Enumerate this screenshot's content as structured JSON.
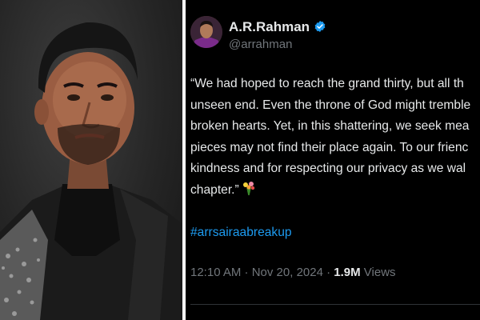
{
  "tweet": {
    "display_name": "A.R.Rahman",
    "handle": "@arrahman",
    "verified_icon": "verified-badge-icon",
    "body_lines": [
      "“We had hoped to reach the grand thirty, but all th",
      "unseen end. Even the throne of God might tremble",
      "broken hearts. Yet, in this shattering, we seek mea",
      "pieces may not find their place again. To our frienc",
      "kindness and for respecting our privacy as we wal",
      "chapter.”"
    ],
    "hashtag": "#arrsairaabreakup",
    "time": "12:10 AM · Nov 20, 2024 · ",
    "views_count": "1.9M",
    "views_label": " Views"
  },
  "colors": {
    "background": "#000000",
    "text": "#e7e9ea",
    "muted": "#71767b",
    "link": "#1d9bf0",
    "verified": "#1d9bf0"
  },
  "photo": {
    "subject_icon": "portrait-photo"
  }
}
